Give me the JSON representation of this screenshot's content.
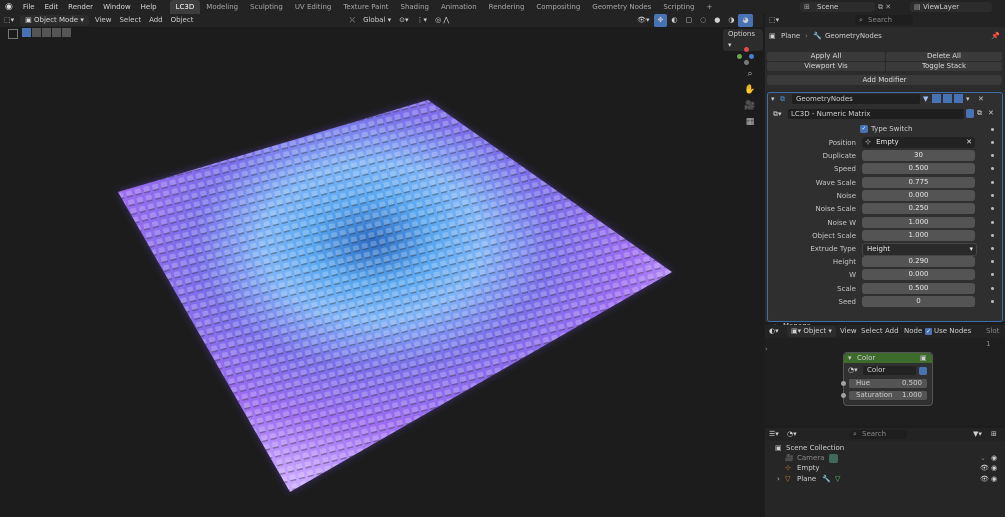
{
  "menu": {
    "items": [
      "File",
      "Edit",
      "Render",
      "Window",
      "Help"
    ]
  },
  "workspaces": {
    "tabs": [
      "LC3D",
      "Modeling",
      "Sculpting",
      "UV Editing",
      "Texture Paint",
      "Shading",
      "Animation",
      "Rendering",
      "Compositing",
      "Geometry Nodes",
      "Scripting"
    ],
    "add": "+"
  },
  "topright": {
    "scene": "Scene",
    "viewlayer": "ViewLayer"
  },
  "viewport_header": {
    "mode": "Object Mode",
    "view": "View",
    "select": "Select",
    "add": "Add",
    "object": "Object",
    "orientation": "Global",
    "options": "Options"
  },
  "properties": {
    "search_placeholder": "Search",
    "breadcrumb_object": "Plane",
    "breadcrumb_modifier": "GeometryNodes",
    "apply_all": "Apply All",
    "delete_all": "Delete All",
    "viewport_vis": "Viewport Vis",
    "toggle_stack": "Toggle Stack",
    "add_modifier": "Add Modifier",
    "modifier_name": "GeometryNodes",
    "node_group": "LC3D - Numeric Matrix",
    "type_switch": "Type Switch",
    "position_label": "Position",
    "position_value": "Empty",
    "fields": [
      {
        "label": "Duplicate",
        "value": "30"
      },
      {
        "label": "Speed",
        "value": "0.500"
      },
      {
        "label": "Wave Scale",
        "value": "0.775"
      },
      {
        "label": "Noise",
        "value": "0.000"
      },
      {
        "label": "Noise Scale",
        "value": "0.250"
      },
      {
        "label": "Noise W",
        "value": "1.000"
      },
      {
        "label": "Object Scale",
        "value": "1.000"
      }
    ],
    "extrude_label": "Extrude Type",
    "extrude_value": "Height",
    "fields2": [
      {
        "label": "Height",
        "value": "0.290"
      },
      {
        "label": "W",
        "value": "0.000"
      },
      {
        "label": "Scale",
        "value": "0.500"
      },
      {
        "label": "Seed",
        "value": "0"
      }
    ],
    "manage": "Manage"
  },
  "node_editor": {
    "object": "Object",
    "view": "View",
    "select": "Select",
    "add": "Add",
    "node": "Node",
    "use_nodes": "Use Nodes",
    "slot": "Slot 1",
    "node_title": "Color",
    "node_color": "Color",
    "hue_label": "Hue",
    "hue_value": "0.500",
    "sat_label": "Saturation",
    "sat_value": "1.000"
  },
  "outliner": {
    "search_placeholder": "Search",
    "collection": "Scene Collection",
    "items": [
      "Camera",
      "Empty",
      "Plane"
    ]
  },
  "colors": {
    "accent": "#4772b3",
    "node_header": "#3c6b2b",
    "tab_active": "#3d3d3d"
  }
}
